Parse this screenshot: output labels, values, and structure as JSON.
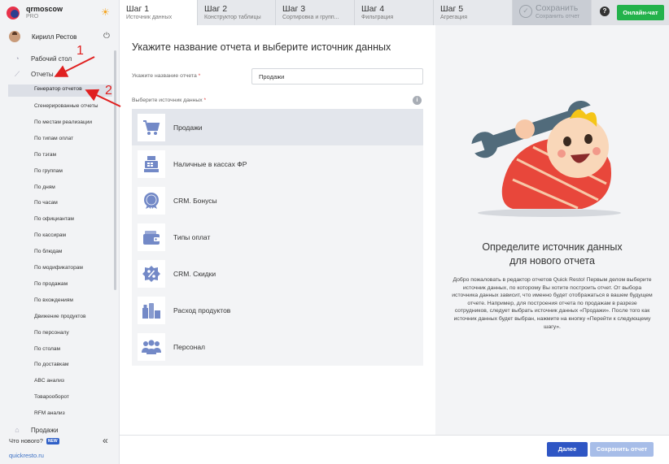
{
  "account": {
    "name": "qrmoscow",
    "plan": "PRO"
  },
  "user": {
    "name": "Кирилл Рестов"
  },
  "sidebar": {
    "top_items": [
      {
        "label": "Рабочий стол",
        "icon": "speedometer-icon"
      },
      {
        "label": "Отчеты",
        "icon": "chart-icon"
      }
    ],
    "active_sub": "Генератор отчетов",
    "sub_items": [
      "Сгенерированные отчеты",
      "По местам реализации",
      "По типам оплат",
      "По тэгам",
      "По группам",
      "По дням",
      "По часам",
      "По официантам",
      "По кассирам",
      "По блюдам",
      "По модификаторам",
      "По продажам",
      "По вхождениям",
      "Движение продуктов",
      "По персоналу",
      "По столам",
      "По доставкам",
      "ABC анализ",
      "Товарооборот",
      "RFM анализ"
    ],
    "bottom_item": "Продажи",
    "whats_new": "Что нового?",
    "new_badge": "NEW",
    "site": "quickresto.ru"
  },
  "tabs": [
    {
      "step": "Шаг 1",
      "sub": "Источник данных"
    },
    {
      "step": "Шаг 2",
      "sub": "Конструктор таблицы"
    },
    {
      "step": "Шаг 3",
      "sub": "Сортировка и групп..."
    },
    {
      "step": "Шаг 4",
      "sub": "Фильтрация"
    },
    {
      "step": "Шаг 5",
      "sub": "Агрегация"
    }
  ],
  "save_tab": {
    "title": "Сохранить",
    "sub": "Сохранить отчет"
  },
  "chat_button": "Онлайн-чат",
  "help": "?",
  "form": {
    "title": "Укажите название отчета и выберите источник данных",
    "name_label": "Укажите название отчета",
    "name_value": "Продажи",
    "source_label": "Выберите источник данных",
    "required_mark": "*",
    "info": "i"
  },
  "sources": [
    {
      "label": "Продажи",
      "icon": "cart-icon"
    },
    {
      "label": "Наличные в кассах ФР",
      "icon": "cash-register-icon"
    },
    {
      "label": "CRM. Бонусы",
      "icon": "bonus-badge-icon"
    },
    {
      "label": "Типы оплат",
      "icon": "wallet-icon"
    },
    {
      "label": "CRM. Скидки",
      "icon": "discount-badge-icon"
    },
    {
      "label": "Расход продуктов",
      "icon": "products-icon"
    },
    {
      "label": "Персонал",
      "icon": "staff-icon"
    }
  ],
  "info_panel": {
    "title_line1": "Определите источник данных",
    "title_line2": "для нового отчета",
    "text": "Добро пожаловать в редактор отчетов Quick Resto! Первым делом выберите источник данных, по которому Вы хотите построить отчет. От выбора источника данных зависит, что именно будет отображаться в вашем будущем отчете. Например, для построения отчета по продажам в разрезе сотрудников, следует выбрать источник данных «Продажи». После того как источник данных будет выбран, нажмите на кнопку «Перейти к следующему шагу»."
  },
  "footer": {
    "next": "Далее",
    "save": "Сохранить отчет"
  },
  "annotations": [
    "1",
    "2"
  ],
  "colors": {
    "accent_blue": "#2f56c4",
    "chat_green": "#23b24b",
    "icon_blue": "#7389c7",
    "arrow_red": "#e02020"
  }
}
